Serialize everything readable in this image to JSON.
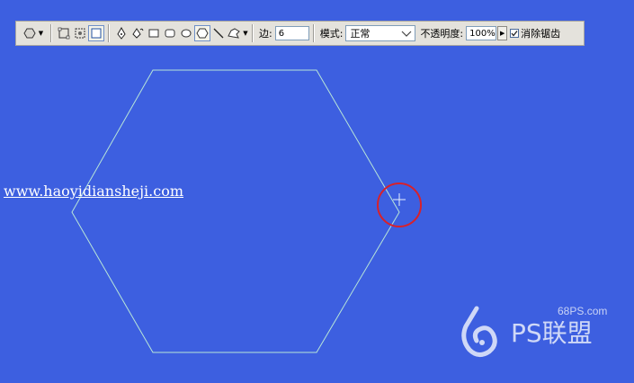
{
  "toolbar": {
    "sides_label": "边:",
    "sides_value": "6",
    "mode_label": "模式:",
    "mode_value": "正常",
    "opacity_label": "不透明度:",
    "opacity_value": "100%",
    "antialias_label": "消除锯齿",
    "antialias_checked": true
  },
  "canvas": {
    "url_text": "www.haoyidiansheji.com",
    "background_color": "#3d5fe0",
    "shape_stroke_color": "#b8e6d8",
    "highlight_circle_color": "#d8212a"
  },
  "watermark": {
    "domain": "68PS.com",
    "brand": "PS联盟"
  }
}
